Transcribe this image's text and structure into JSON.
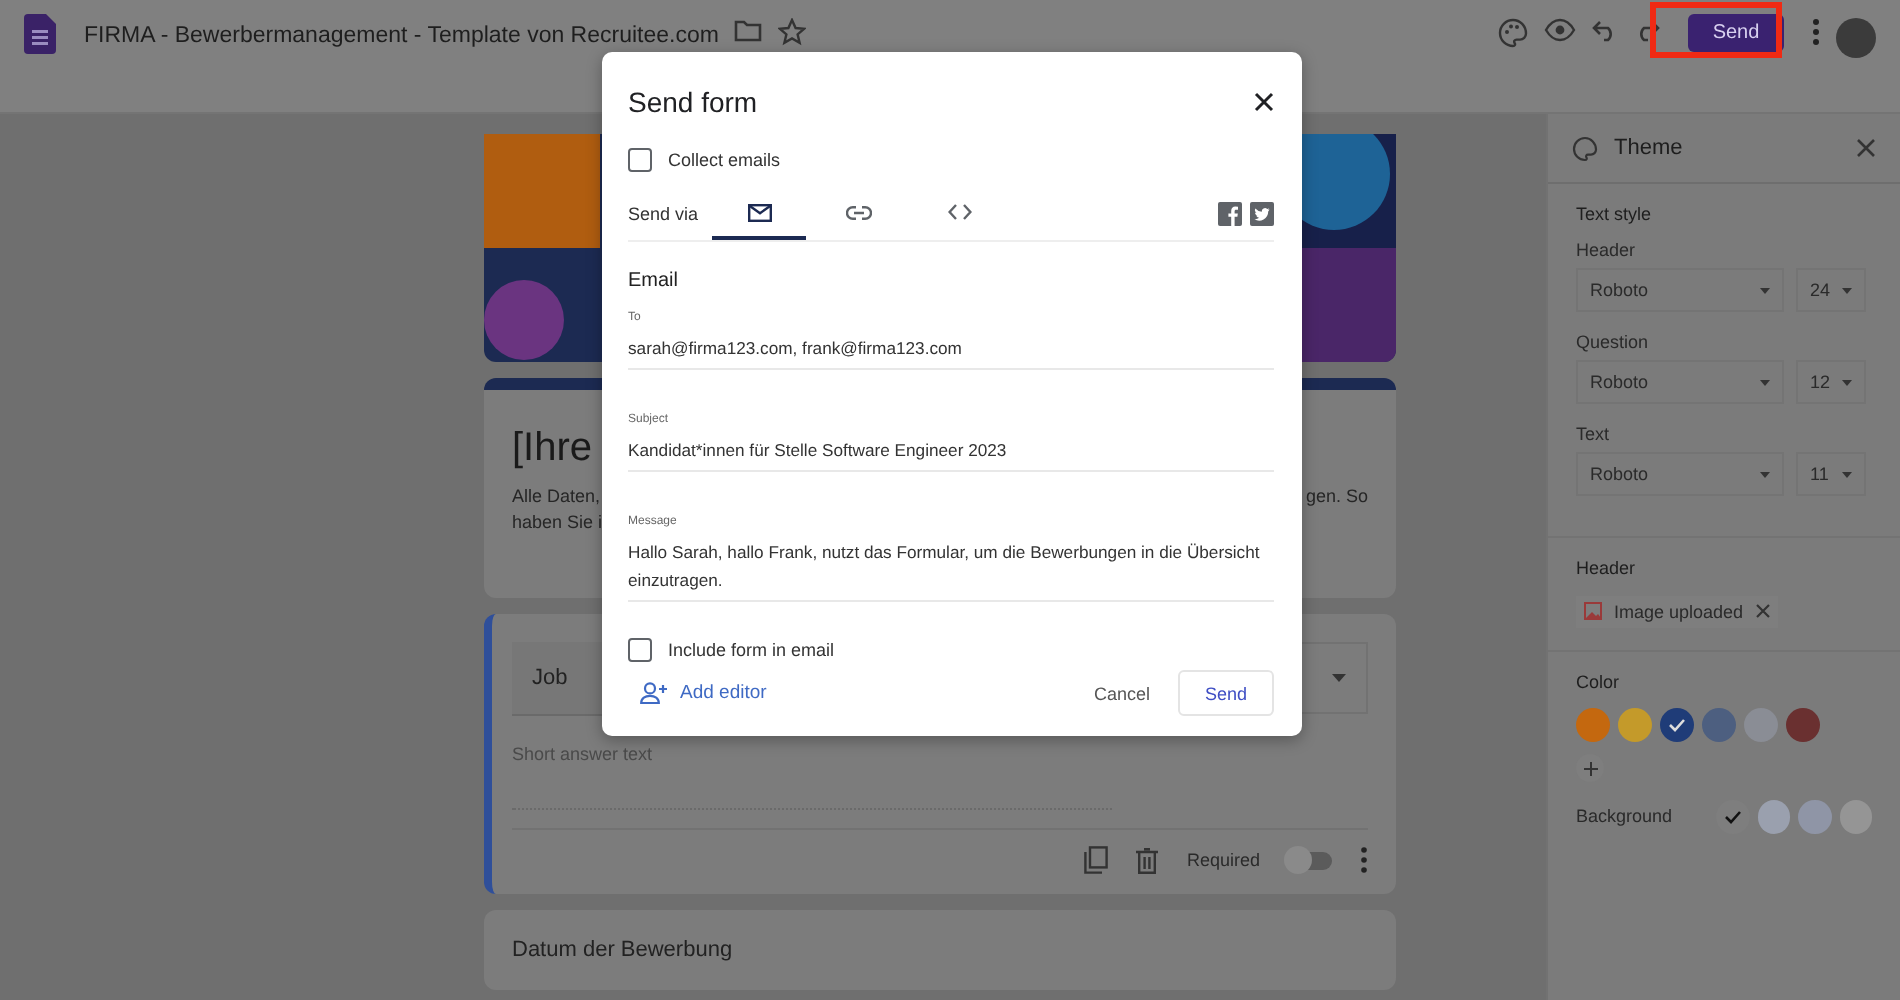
{
  "top_bar": {
    "title": "FIRMA - Bewerbermanagement - Template von Recruitee.com",
    "send_button": "Send",
    "send_highlighted": true
  },
  "form": {
    "title": "[Ihre",
    "description_left": [
      "Alle Daten,",
      "haben Sie i"
    ],
    "description_right": "gen. So",
    "question": {
      "title": "Job",
      "placeholder": "Short answer text",
      "required_label": "Required",
      "required": false
    },
    "next_question": "Datum der Bewerbung"
  },
  "dialog": {
    "title": "Send form",
    "collect_emails": {
      "label": "Collect emails",
      "checked": false
    },
    "send_via_label": "Send via",
    "tabs": [
      {
        "kind": "email",
        "selected": true
      },
      {
        "kind": "link",
        "selected": false
      },
      {
        "kind": "embed",
        "selected": false
      }
    ],
    "section_title": "Email",
    "fields": [
      {
        "label": "To",
        "value": "sarah@firma123.com, frank@firma123.com"
      },
      {
        "label": "Subject",
        "value": "Kandidat*innen für Stelle Software Engineer 2023"
      },
      {
        "label": "Message",
        "value": "Hallo Sarah, hallo Frank, nutzt das Formular, um die Bewerbungen in die Übersicht einzutragen."
      }
    ],
    "include_form": {
      "label": "Include form in email",
      "checked": false
    },
    "add_editor": "Add editor",
    "cancel": "Cancel",
    "send": "Send"
  },
  "theme_panel": {
    "title": "Theme",
    "text_style_title": "Text style",
    "text_styles": [
      {
        "label": "Header",
        "font": "Roboto",
        "size": "24"
      },
      {
        "label": "Question",
        "font": "Roboto",
        "size": "12"
      },
      {
        "label": "Text",
        "font": "Roboto",
        "size": "11"
      }
    ],
    "header_title": "Header",
    "header_chip": "Image uploaded",
    "color_title": "Color",
    "colors": [
      {
        "color": "#c4680f",
        "selected": false
      },
      {
        "color": "#c49a2a",
        "selected": false
      },
      {
        "color": "#1f3c78",
        "selected": true
      },
      {
        "color": "#4d5f80",
        "selected": false
      },
      {
        "color": "#8a8d95",
        "selected": false
      },
      {
        "color": "#6a3030",
        "selected": false
      }
    ],
    "background_label": "Background",
    "backgrounds": [
      {
        "color": "#7e7e7e",
        "selected": true
      },
      {
        "color": "#9aa0ae",
        "selected": false
      },
      {
        "color": "#8f95a6",
        "selected": false
      },
      {
        "color": "#959595",
        "selected": false
      }
    ]
  }
}
